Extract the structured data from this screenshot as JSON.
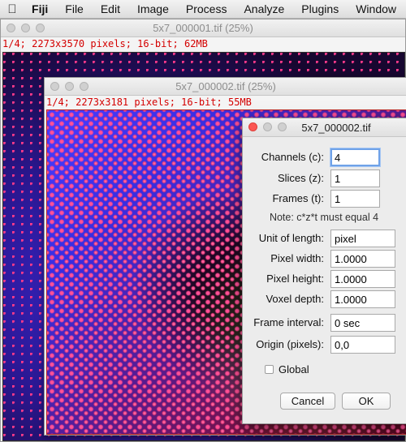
{
  "menubar": {
    "app": "Fiji",
    "items": [
      "File",
      "Edit",
      "Image",
      "Process",
      "Analyze",
      "Plugins",
      "Window"
    ]
  },
  "window1": {
    "title": "5x7_000001.tif (25%)",
    "info": "1/4; 2273x3570 pixels; 16-bit; 62MB"
  },
  "window2": {
    "title": "5x7_000002.tif (25%)",
    "info": "1/4; 2273x3181 pixels; 16-bit; 55MB"
  },
  "dialog": {
    "title": "5x7_000002.tif",
    "channels_label": "Channels (c):",
    "channels_value": "4",
    "slices_label": "Slices (z):",
    "slices_value": "1",
    "frames_label": "Frames (t):",
    "frames_value": "1",
    "note": "Note: c*z*t must equal 4",
    "unit_label": "Unit of length:",
    "unit_value": "pixel",
    "pw_label": "Pixel width:",
    "pw_value": "1.0000",
    "ph_label": "Pixel height:",
    "ph_value": "1.0000",
    "vd_label": "Voxel depth:",
    "vd_value": "1.0000",
    "fi_label": "Frame interval:",
    "fi_value": "0 sec",
    "origin_label": "Origin (pixels):",
    "origin_value": "0,0",
    "global_label": "Global",
    "cancel": "Cancel",
    "ok": "OK"
  },
  "colors": {
    "info_text": "#d40000",
    "close_button": "#fc5753",
    "focus_ring": "#6fa2e8"
  }
}
